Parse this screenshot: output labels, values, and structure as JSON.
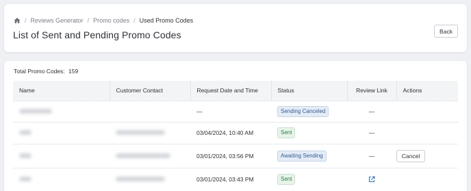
{
  "breadcrumb": {
    "items": [
      "Reviews Generator",
      "Promo codes",
      "Used Promo Codes"
    ]
  },
  "header": {
    "title": "List of Sent and Pending Promo Codes",
    "back_label": "Back"
  },
  "summary": {
    "total_label": "Total Promo Codes:",
    "total_value": "159"
  },
  "table": {
    "columns": [
      "Name",
      "Customer Contact",
      "Request Date and Time",
      "Status",
      "Review Link",
      "Actions"
    ],
    "rows": [
      {
        "request_date": "—",
        "status": "Sending Canceled",
        "review_link": "—"
      },
      {
        "request_date": "03/04/2024, 10:40 AM",
        "status": "Sent",
        "review_link": "—"
      },
      {
        "request_date": "03/01/2024, 03:56 PM",
        "status": "Awaiting Sending",
        "review_link": "—",
        "action": "Cancel"
      },
      {
        "request_date": "03/01/2024, 03:43 PM",
        "status": "Sent",
        "review_link_icon": "external-link-icon"
      }
    ]
  },
  "colors": {
    "link": "#2f6fd0",
    "sent_badge": "#2f7a44",
    "pending_badge": "#2f5f97"
  }
}
